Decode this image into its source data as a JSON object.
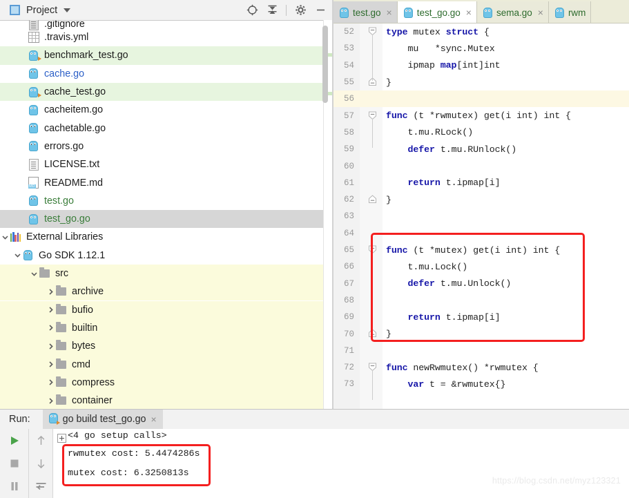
{
  "project_panel": {
    "title": "Project",
    "caret_icon": "chevron-down-icon",
    "header_icons": [
      {
        "name": "locate-icon",
        "label": "⊕"
      },
      {
        "name": "collapse-all-icon",
        "label": "⤓"
      },
      {
        "name": "gear-icon",
        "label": "⚙"
      },
      {
        "name": "minimize-icon",
        "label": "—"
      }
    ],
    "tree": [
      {
        "label": ".gitignore",
        "icon": "file-icon",
        "indent": 40,
        "style": "clipped",
        "arrow": ""
      },
      {
        "label": ".travis.yml",
        "icon": "yaml-icon",
        "indent": 40,
        "style": "plain",
        "arrow": ""
      },
      {
        "label": "benchmark_test.go",
        "icon": "go-test-icon",
        "indent": 40,
        "style": "green",
        "arrow": ""
      },
      {
        "label": "cache.go",
        "icon": "go-icon",
        "indent": 40,
        "style": "blue-text",
        "arrow": ""
      },
      {
        "label": "cache_test.go",
        "icon": "go-test-icon",
        "indent": 40,
        "style": "green",
        "arrow": ""
      },
      {
        "label": "cacheitem.go",
        "icon": "go-icon",
        "indent": 40,
        "style": "plain",
        "arrow": ""
      },
      {
        "label": "cachetable.go",
        "icon": "go-icon",
        "indent": 40,
        "style": "plain",
        "arrow": ""
      },
      {
        "label": "errors.go",
        "icon": "go-icon",
        "indent": 40,
        "style": "plain",
        "arrow": ""
      },
      {
        "label": "LICENSE.txt",
        "icon": "text-file-icon",
        "indent": 40,
        "style": "plain",
        "arrow": ""
      },
      {
        "label": "README.md",
        "icon": "markdown-icon",
        "indent": 40,
        "style": "plain",
        "arrow": ""
      },
      {
        "label": "test.go",
        "icon": "go-icon",
        "indent": 40,
        "style": "green-text",
        "arrow": ""
      },
      {
        "label": "test_go.go",
        "icon": "go-icon",
        "indent": 40,
        "style": "selected",
        "arrow": ""
      },
      {
        "label": "External Libraries",
        "icon": "library-icon",
        "indent": 8,
        "style": "plain",
        "arrow": "down"
      },
      {
        "label": "Go SDK 1.12.1",
        "icon": "go-icon",
        "indent": 32,
        "style": "plain",
        "arrow": "down"
      },
      {
        "label": "src",
        "icon": "folder-icon",
        "indent": 56,
        "style": "yellow",
        "arrow": "down"
      },
      {
        "label": "archive",
        "icon": "folder-icon",
        "indent": 80,
        "style": "yellow",
        "arrow": "right"
      },
      {
        "label": "bufio",
        "icon": "folder-icon",
        "indent": 80,
        "style": "yellow",
        "arrow": "right"
      },
      {
        "label": "builtin",
        "icon": "folder-icon",
        "indent": 80,
        "style": "yellow",
        "arrow": "right"
      },
      {
        "label": "bytes",
        "icon": "folder-icon",
        "indent": 80,
        "style": "yellow",
        "arrow": "right"
      },
      {
        "label": "cmd",
        "icon": "folder-icon",
        "indent": 80,
        "style": "yellow",
        "arrow": "right"
      },
      {
        "label": "compress",
        "icon": "folder-icon",
        "indent": 80,
        "style": "yellow",
        "arrow": "right"
      },
      {
        "label": "container",
        "icon": "folder-icon",
        "indent": 80,
        "style": "yellow",
        "arrow": "right"
      }
    ]
  },
  "editor": {
    "tabs": [
      {
        "label": "test.go",
        "state": "inactive-gray",
        "close": "×"
      },
      {
        "label": "test_go.go",
        "state": "active",
        "close": "×"
      },
      {
        "label": "sema.go",
        "state": "inactive-tan",
        "close": "×"
      },
      {
        "label": "rwm",
        "state": "inactive-tan",
        "close": ""
      }
    ],
    "caret_line": 56,
    "lines": [
      {
        "n": 52,
        "text": "type mutex struct {",
        "kw": [
          "type",
          "struct"
        ],
        "fold": "open"
      },
      {
        "n": 53,
        "text": "    mu   *sync.Mutex",
        "kw": [],
        "fold": ""
      },
      {
        "n": 54,
        "text": "    ipmap map[int]int",
        "kw": [
          "map"
        ],
        "fold": ""
      },
      {
        "n": 55,
        "text": "}",
        "kw": [],
        "fold": "close"
      },
      {
        "n": 56,
        "text": "",
        "kw": [],
        "fold": ""
      },
      {
        "n": 57,
        "text": "func (t *rwmutex) get(i int) int {",
        "kw": [
          "func"
        ],
        "fold": "open"
      },
      {
        "n": 58,
        "text": "    t.mu.RLock()",
        "kw": [],
        "fold": ""
      },
      {
        "n": 59,
        "text": "    defer t.mu.RUnlock()",
        "kw": [
          "defer"
        ],
        "fold": ""
      },
      {
        "n": 60,
        "text": "",
        "kw": [],
        "fold": ""
      },
      {
        "n": 61,
        "text": "    return t.ipmap[i]",
        "kw": [
          "return"
        ],
        "fold": ""
      },
      {
        "n": 62,
        "text": "}",
        "kw": [],
        "fold": "close"
      },
      {
        "n": 63,
        "text": "",
        "kw": [],
        "fold": ""
      },
      {
        "n": 64,
        "text": "",
        "kw": [],
        "fold": ""
      },
      {
        "n": 65,
        "text": "func (t *mutex) get(i int) int {",
        "kw": [
          "func"
        ],
        "fold": "open"
      },
      {
        "n": 66,
        "text": "    t.mu.Lock()",
        "kw": [],
        "fold": ""
      },
      {
        "n": 67,
        "text": "    defer t.mu.Unlock()",
        "kw": [
          "defer"
        ],
        "fold": ""
      },
      {
        "n": 68,
        "text": "",
        "kw": [],
        "fold": ""
      },
      {
        "n": 69,
        "text": "    return t.ipmap[i]",
        "kw": [
          "return"
        ],
        "fold": ""
      },
      {
        "n": 70,
        "text": "}",
        "kw": [],
        "fold": "close"
      },
      {
        "n": 71,
        "text": "",
        "kw": [],
        "fold": ""
      },
      {
        "n": 72,
        "text": "func newRwmutex() *rwmutex {",
        "kw": [
          "func"
        ],
        "fold": "open"
      },
      {
        "n": 73,
        "text": "    var t = &rwmutex{}",
        "kw": [
          "var"
        ],
        "fold": ""
      }
    ],
    "highlight_color": "#f41f1f"
  },
  "run_panel": {
    "label": "Run:",
    "tab_label": "go build test_go.go",
    "tab_close": "×",
    "toolbar": [
      {
        "name": "run-button",
        "glyph": "▶"
      },
      {
        "name": "stop-button",
        "glyph": "■"
      },
      {
        "name": "pause-button",
        "glyph": "‖"
      }
    ],
    "toolbar2": [
      {
        "name": "scroll-up-button",
        "glyph": "↑"
      },
      {
        "name": "scroll-down-button",
        "glyph": "↓"
      },
      {
        "name": "soft-wrap-button",
        "glyph": "↩"
      }
    ],
    "output": [
      {
        "text": "<4 go setup calls>",
        "fold": true
      },
      {
        "text": "rwmutex cost: 5.4474286s",
        "fold": false
      },
      {
        "text": "mutex cost: 6.3250813s",
        "fold": false
      }
    ]
  },
  "watermark": "https://blog.csdn.net/myz123321"
}
